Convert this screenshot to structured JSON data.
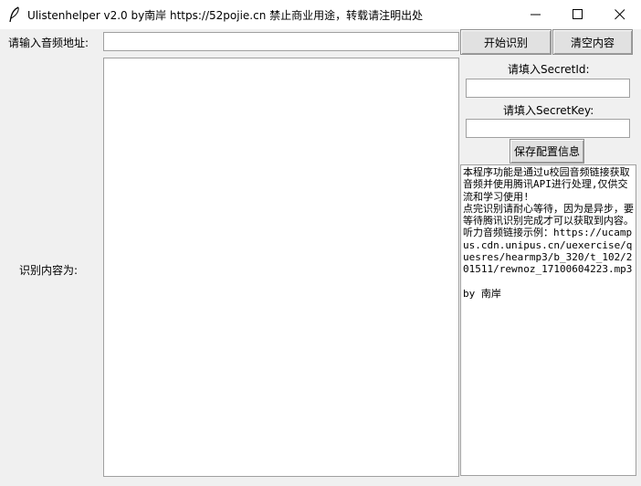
{
  "window": {
    "title": "Ulistenhelper v2.0 by南岸 https://52pojie.cn 禁止商业用途，转载请注明出处",
    "controls": [
      "minimize-icon",
      "maximize-icon",
      "close-icon"
    ]
  },
  "form": {
    "url_label": "请输入音频地址:",
    "url_value": "",
    "result_label": "识别内容为:",
    "result_value": ""
  },
  "buttons": {
    "start": "开始识别",
    "clear": "清空内容",
    "save": "保存配置信息"
  },
  "config": {
    "secret_id_label": "请填入SecretId:",
    "secret_id_value": "",
    "secret_key_label": "请填入SecretKey:",
    "secret_key_value": ""
  },
  "info": {
    "text": "本程序功能是通过u校园音频链接获取音频并使用腾讯API进行处理,仅供交流和学习使用!\n点完识别请耐心等待，因为是异步，要等待腾讯识别完成才可以获取到内容。\n听力音频链接示例：https://ucampus.cdn.unipus.cn/uexercise/quesres/hearmp3/b_320/t_102/201511/rewnoz_17100604223.mp3\n\nby 南岸"
  }
}
